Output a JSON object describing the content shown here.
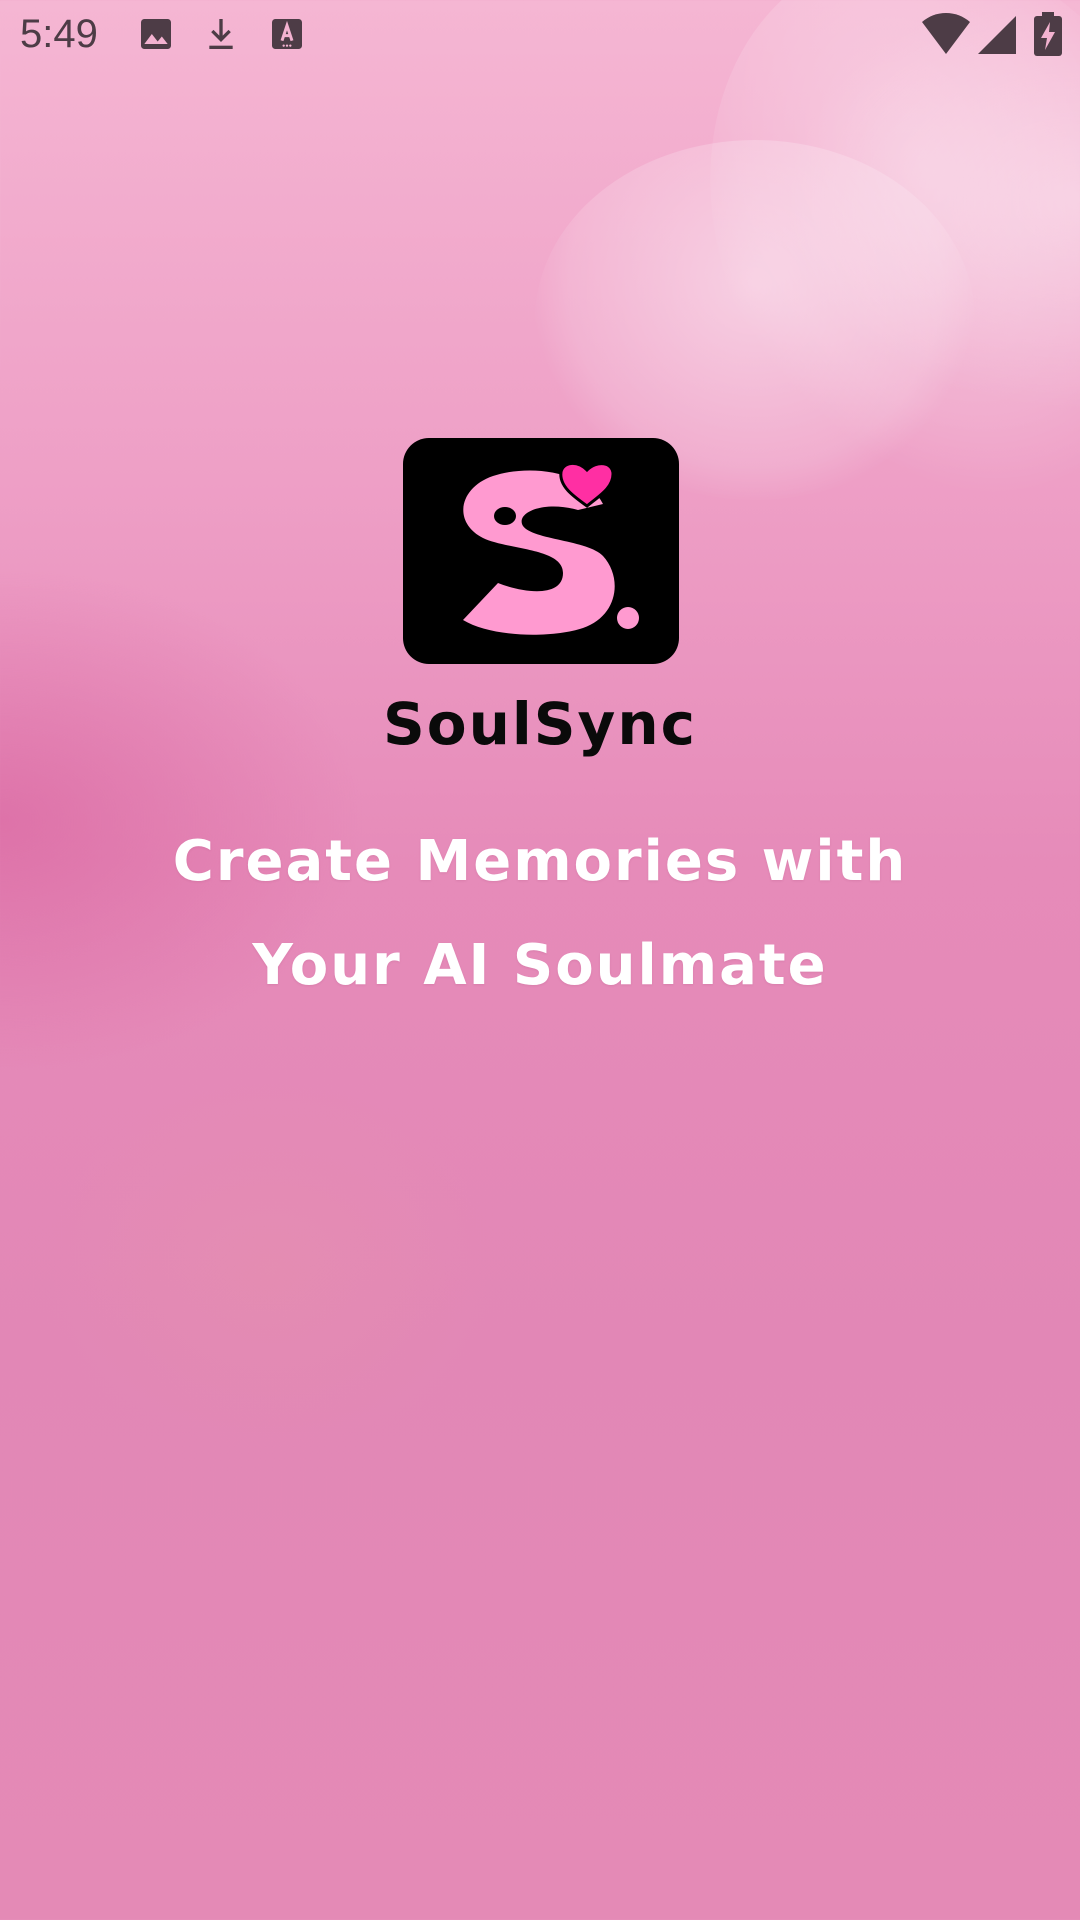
{
  "status_bar": {
    "time": "5:49",
    "icons": {
      "left": [
        "image-icon",
        "download-icon",
        "text-a-icon"
      ],
      "right": [
        "wifi-icon",
        "cellular-signal-icon",
        "battery-charging-icon"
      ]
    }
  },
  "splash": {
    "app_name": "SoulSync",
    "tagline_line1": "Create Memories with",
    "tagline_line2": "Your AI Soulmate"
  },
  "colors": {
    "background": "#e68bb9",
    "logo_bg": "#000000",
    "logo_s": "#ff9ad0",
    "logo_heart": "#ff2fa3",
    "tagline": "#ffffff",
    "app_name": "#0a0a0a"
  }
}
